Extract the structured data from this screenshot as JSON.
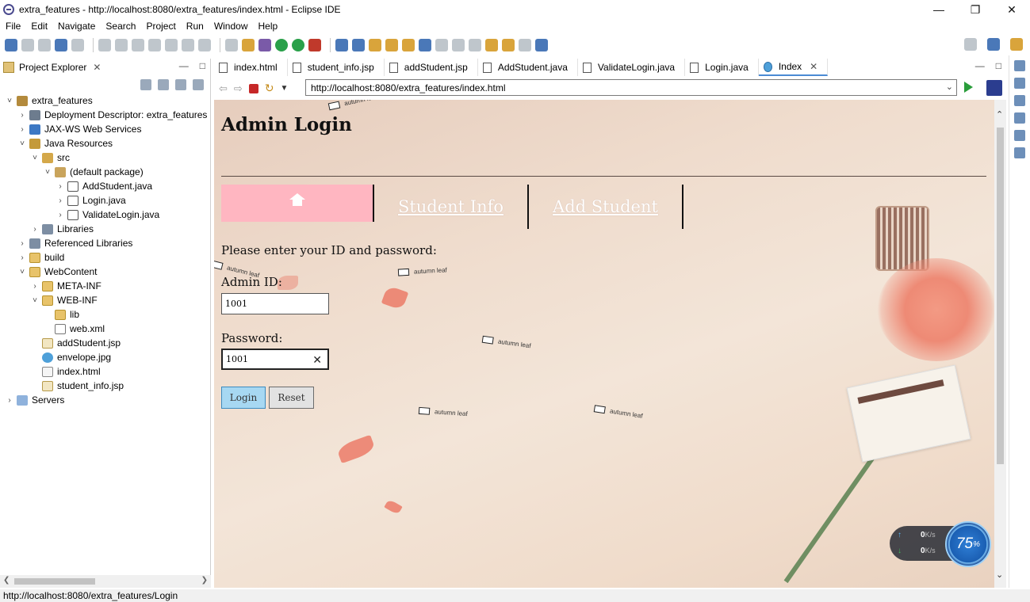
{
  "window": {
    "title": "extra_features - http://localhost:8080/extra_features/index.html - Eclipse IDE"
  },
  "menu": [
    "File",
    "Edit",
    "Navigate",
    "Search",
    "Project",
    "Run",
    "Window",
    "Help"
  ],
  "project_explorer": {
    "title": "Project Explorer",
    "tree": [
      {
        "label": "extra_features",
        "level": 0,
        "expanded": true,
        "icon": "project-icon"
      },
      {
        "label": "Deployment Descriptor: extra_features",
        "level": 1,
        "expanded": false,
        "icon": "deployment-descriptor-icon"
      },
      {
        "label": "JAX-WS Web Services",
        "level": 1,
        "expanded": false,
        "icon": "web-services-icon"
      },
      {
        "label": "Java Resources",
        "level": 1,
        "expanded": true,
        "icon": "java-resources-icon"
      },
      {
        "label": "src",
        "level": 2,
        "expanded": true,
        "icon": "source-folder-icon"
      },
      {
        "label": "(default package)",
        "level": 3,
        "expanded": true,
        "icon": "package-icon"
      },
      {
        "label": "AddStudent.java",
        "level": 4,
        "expanded": false,
        "icon": "java-file-icon"
      },
      {
        "label": "Login.java",
        "level": 4,
        "expanded": false,
        "icon": "java-file-icon"
      },
      {
        "label": "ValidateLogin.java",
        "level": 4,
        "expanded": false,
        "icon": "java-file-icon"
      },
      {
        "label": "Libraries",
        "level": 2,
        "expanded": false,
        "icon": "library-icon"
      },
      {
        "label": "Referenced Libraries",
        "level": 1,
        "expanded": false,
        "icon": "library-icon"
      },
      {
        "label": "build",
        "level": 1,
        "expanded": false,
        "icon": "folder-icon"
      },
      {
        "label": "WebContent",
        "level": 1,
        "expanded": true,
        "icon": "folder-icon"
      },
      {
        "label": "META-INF",
        "level": 2,
        "expanded": false,
        "icon": "folder-icon"
      },
      {
        "label": "WEB-INF",
        "level": 2,
        "expanded": true,
        "icon": "folder-icon"
      },
      {
        "label": "lib",
        "level": 3,
        "expanded": null,
        "icon": "folder-icon"
      },
      {
        "label": "web.xml",
        "level": 3,
        "expanded": null,
        "icon": "xml-file-icon"
      },
      {
        "label": "addStudent.jsp",
        "level": 2,
        "expanded": null,
        "icon": "jsp-file-icon"
      },
      {
        "label": "envelope.jpg",
        "level": 2,
        "expanded": null,
        "icon": "image-file-icon"
      },
      {
        "label": "index.html",
        "level": 2,
        "expanded": null,
        "icon": "html-file-icon"
      },
      {
        "label": "student_info.jsp",
        "level": 2,
        "expanded": null,
        "icon": "jsp-file-icon"
      },
      {
        "label": "Servers",
        "level": 0,
        "expanded": false,
        "icon": "servers-icon"
      }
    ]
  },
  "editor_tabs": [
    {
      "label": "index.html",
      "active": false
    },
    {
      "label": "student_info.jsp",
      "active": false
    },
    {
      "label": "addStudent.jsp",
      "active": false
    },
    {
      "label": "AddStudent.java",
      "active": false
    },
    {
      "label": "ValidateLogin.java",
      "active": false
    },
    {
      "label": "Login.java",
      "active": false
    },
    {
      "label": "Index",
      "active": true
    }
  ],
  "browser": {
    "url": "http://localhost:8080/extra_features/index.html"
  },
  "page": {
    "title": "Admin Login",
    "nav": {
      "student_info": "Student Info",
      "add_student": "Add Student"
    },
    "prompt": "Please enter your ID and password:",
    "admin_id_label": "Admin ID:",
    "admin_id_value": "1001",
    "password_label": "Password:",
    "password_value": "1001",
    "login_button": "Login",
    "reset_button": "Reset",
    "watermark": "autumn leaf",
    "colors": {
      "nav_home_bg": "#ffb6c1",
      "login_button_bg": "#a7d8f2"
    }
  },
  "net_widget": {
    "up": "0",
    "down": "0",
    "unit": "K/s",
    "percent": "75",
    "percent_sign": "%"
  },
  "status": {
    "text": "http://localhost:8080/extra_features/Login"
  }
}
